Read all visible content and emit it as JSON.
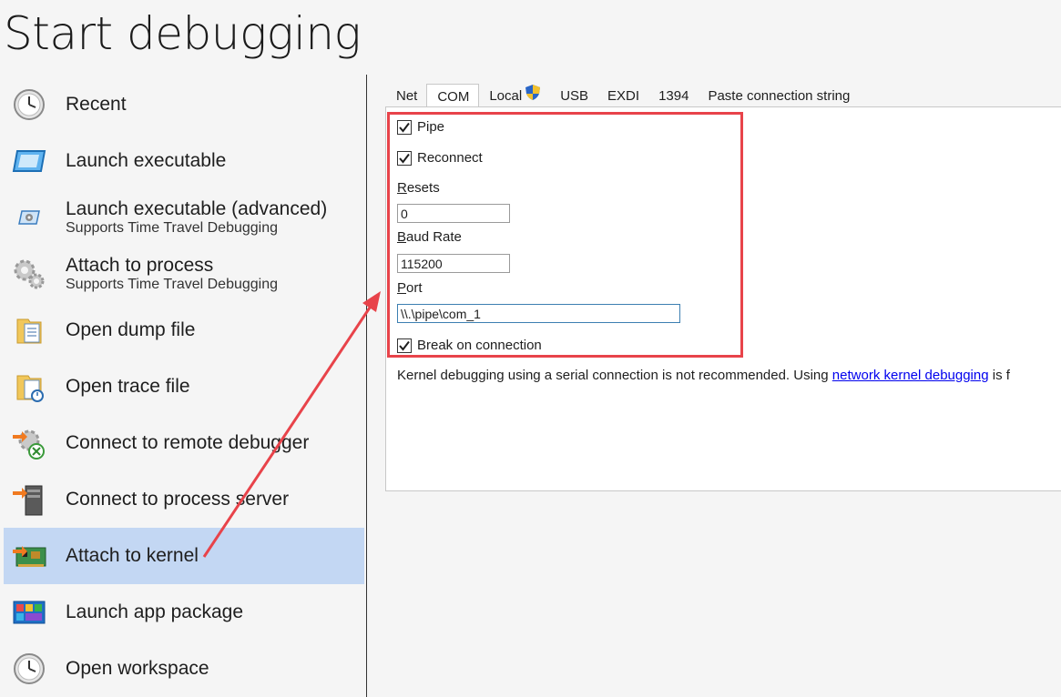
{
  "page": {
    "title": "Start debugging"
  },
  "sidebar": {
    "items": [
      {
        "label": "Recent",
        "sub": "",
        "icon": "clock-icon"
      },
      {
        "label": "Launch executable",
        "sub": "",
        "icon": "window-icon"
      },
      {
        "label": "Launch executable (advanced)",
        "sub": "Supports Time Travel Debugging",
        "icon": "gear-window-icon"
      },
      {
        "label": "Attach to process",
        "sub": "Supports Time Travel Debugging",
        "icon": "gears-icon"
      },
      {
        "label": "Open dump file",
        "sub": "",
        "icon": "dump-file-icon"
      },
      {
        "label": "Open trace file",
        "sub": "",
        "icon": "trace-file-icon"
      },
      {
        "label": "Connect to remote debugger",
        "sub": "",
        "icon": "remote-debugger-icon"
      },
      {
        "label": "Connect to process server",
        "sub": "",
        "icon": "process-server-icon"
      },
      {
        "label": "Attach to kernel",
        "sub": "",
        "icon": "kernel-board-icon",
        "selected": true
      },
      {
        "label": "Launch app package",
        "sub": "",
        "icon": "app-package-icon"
      },
      {
        "label": "Open workspace",
        "sub": "",
        "icon": "clock-icon"
      }
    ]
  },
  "tabs": [
    {
      "label": "Net"
    },
    {
      "label": "COM",
      "active": true
    },
    {
      "label": "Local",
      "icon": "uac-shield-icon"
    },
    {
      "label": "USB"
    },
    {
      "label": "EXDI"
    },
    {
      "label": "1394"
    },
    {
      "label": "Paste connection string"
    }
  ],
  "com": {
    "pipe": {
      "label": "Pipe",
      "checked": true
    },
    "reconnect": {
      "label": "Reconnect",
      "checked": true
    },
    "resets": {
      "label_u": "R",
      "label_rest": "esets",
      "value": "0"
    },
    "baud": {
      "label_u": "B",
      "label_rest": "aud Rate",
      "value": "115200"
    },
    "port": {
      "label_u": "P",
      "label_rest": "ort",
      "value": "\\\\.\\pipe\\com_1"
    },
    "break_on_connection": {
      "label": "Break on connection",
      "checked": true
    },
    "note_prefix": "Kernel debugging using a serial connection is not recommended. Using ",
    "note_link": "network kernel debugging",
    "note_suffix": " is f"
  },
  "colors": {
    "selected": "#c3d7f3",
    "annotation": "#e8434a",
    "link": "#0000ee"
  }
}
